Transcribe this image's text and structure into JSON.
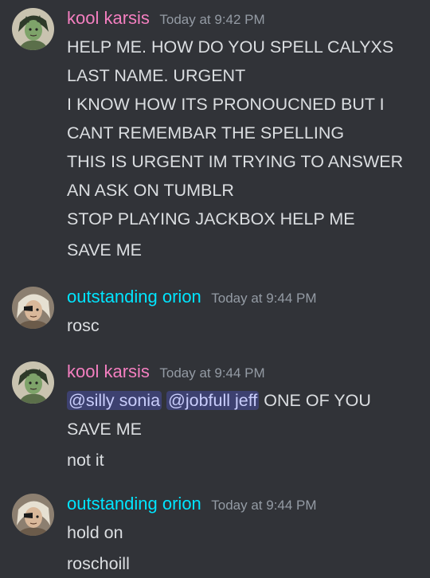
{
  "colors": {
    "background": "#313338",
    "username_karsis": "#f47fc0",
    "username_orion": "#00e5ff",
    "timestamp": "#949ba4",
    "text": "#dbdee1",
    "mention_bg": "#414675"
  },
  "messages": [
    {
      "username": "kool karsis",
      "timestamp": "Today at 9:42 PM",
      "avatar": "karsis-avatar",
      "lines": [
        "HELP ME. HOW DO YOU SPELL CALYXS",
        "LAST NAME. URGENT",
        "I KNOW HOW ITS PRONOUCNED BUT I",
        "CANT REMEMBAR THE SPELLING",
        "THIS IS URGENT IM TRYING TO ANSWER",
        "AN ASK ON TUMBLR",
        "STOP PLAYING JACKBOX HELP ME",
        "SAVE ME"
      ]
    },
    {
      "username": "outstanding orion",
      "timestamp": "Today at 9:44 PM",
      "avatar": "orion-avatar",
      "lines": [
        "rosc"
      ]
    },
    {
      "username": "kool karsis",
      "timestamp": "Today at 9:44 PM",
      "avatar": "karsis-avatar",
      "mentions": [
        "@silly sonia",
        "@jobfull jeff"
      ],
      "mention_line_rest": "ONE OF YOU",
      "lines": [
        "SAVE ME",
        "not it"
      ]
    },
    {
      "username": "outstanding orion",
      "timestamp": "Today at 9:44 PM",
      "avatar": "orion-avatar",
      "lines": [
        "hold on",
        "roschoill"
      ]
    }
  ]
}
